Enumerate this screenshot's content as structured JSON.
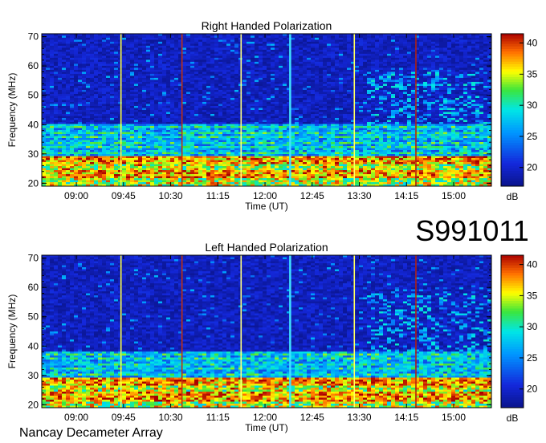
{
  "chart_data": [
    {
      "type": "heatmap",
      "title": "Right Handed Polarization",
      "xlabel": "Time (UT)",
      "ylabel": "Frequency (MHz)",
      "x_ticks": [
        "09:00",
        "09:45",
        "10:30",
        "11:15",
        "12:00",
        "12:45",
        "13:30",
        "14:15",
        "15:00"
      ],
      "x_tick_hours": [
        9.0,
        9.75,
        10.5,
        11.25,
        12.0,
        12.75,
        13.5,
        14.25,
        15.0
      ],
      "xlim": [
        8.45,
        15.6
      ],
      "y_ticks": [
        20,
        30,
        40,
        50,
        60,
        70
      ],
      "ylim": [
        19,
        71
      ],
      "colorbar": {
        "label": "dB",
        "ticks": [
          20,
          25,
          30,
          35,
          40
        ],
        "range": [
          17,
          41.5
        ]
      },
      "features": {
        "strong_band_mhz": [
          22,
          29
        ],
        "moderate_band_mhz": [
          29,
          40
        ],
        "quiet_above_mhz": 40,
        "time_cut_lines": [
          {
            "hour": 9.71,
            "color": "#ffff40"
          },
          {
            "hour": 10.68,
            "color": "#c03010"
          },
          {
            "hour": 11.62,
            "color": "#ffff80"
          },
          {
            "hour": 12.4,
            "color": "#40e0ff"
          },
          {
            "hour": 13.42,
            "color": "#ffff60"
          },
          {
            "hour": 14.4,
            "color": "#b02010"
          }
        ],
        "burst_zone_hours": [
          13.6,
          15.6
        ]
      }
    },
    {
      "type": "heatmap",
      "title": "Left Handed Polarization",
      "xlabel": "Time (UT)",
      "ylabel": "Frequency (MHz)",
      "x_ticks": [
        "09:00",
        "09:45",
        "10:30",
        "11:15",
        "12:00",
        "12:45",
        "13:30",
        "14:15",
        "15:00"
      ],
      "x_tick_hours": [
        9.0,
        9.75,
        10.5,
        11.25,
        12.0,
        12.75,
        13.5,
        14.25,
        15.0
      ],
      "xlim": [
        8.45,
        15.6
      ],
      "y_ticks": [
        20,
        30,
        40,
        50,
        60,
        70
      ],
      "ylim": [
        19,
        71
      ],
      "colorbar": {
        "label": "dB",
        "ticks": [
          20,
          25,
          30,
          35,
          40
        ],
        "range": [
          17,
          41.5
        ]
      },
      "features": {
        "strong_band_mhz": [
          21,
          29
        ],
        "moderate_band_mhz": [
          29,
          38
        ],
        "quiet_above_mhz": 38,
        "time_cut_lines": [
          {
            "hour": 9.71,
            "color": "#ffff40"
          },
          {
            "hour": 10.68,
            "color": "#c03010"
          },
          {
            "hour": 11.62,
            "color": "#ffff80"
          },
          {
            "hour": 12.4,
            "color": "#40e0ff"
          },
          {
            "hour": 13.42,
            "color": "#ffff60"
          },
          {
            "hour": 14.4,
            "color": "#b02010"
          }
        ],
        "burst_zone_hours": [
          13.6,
          15.6
        ]
      }
    }
  ],
  "observation_id": "S991011",
  "instrument": "Nancay Decameter Array"
}
